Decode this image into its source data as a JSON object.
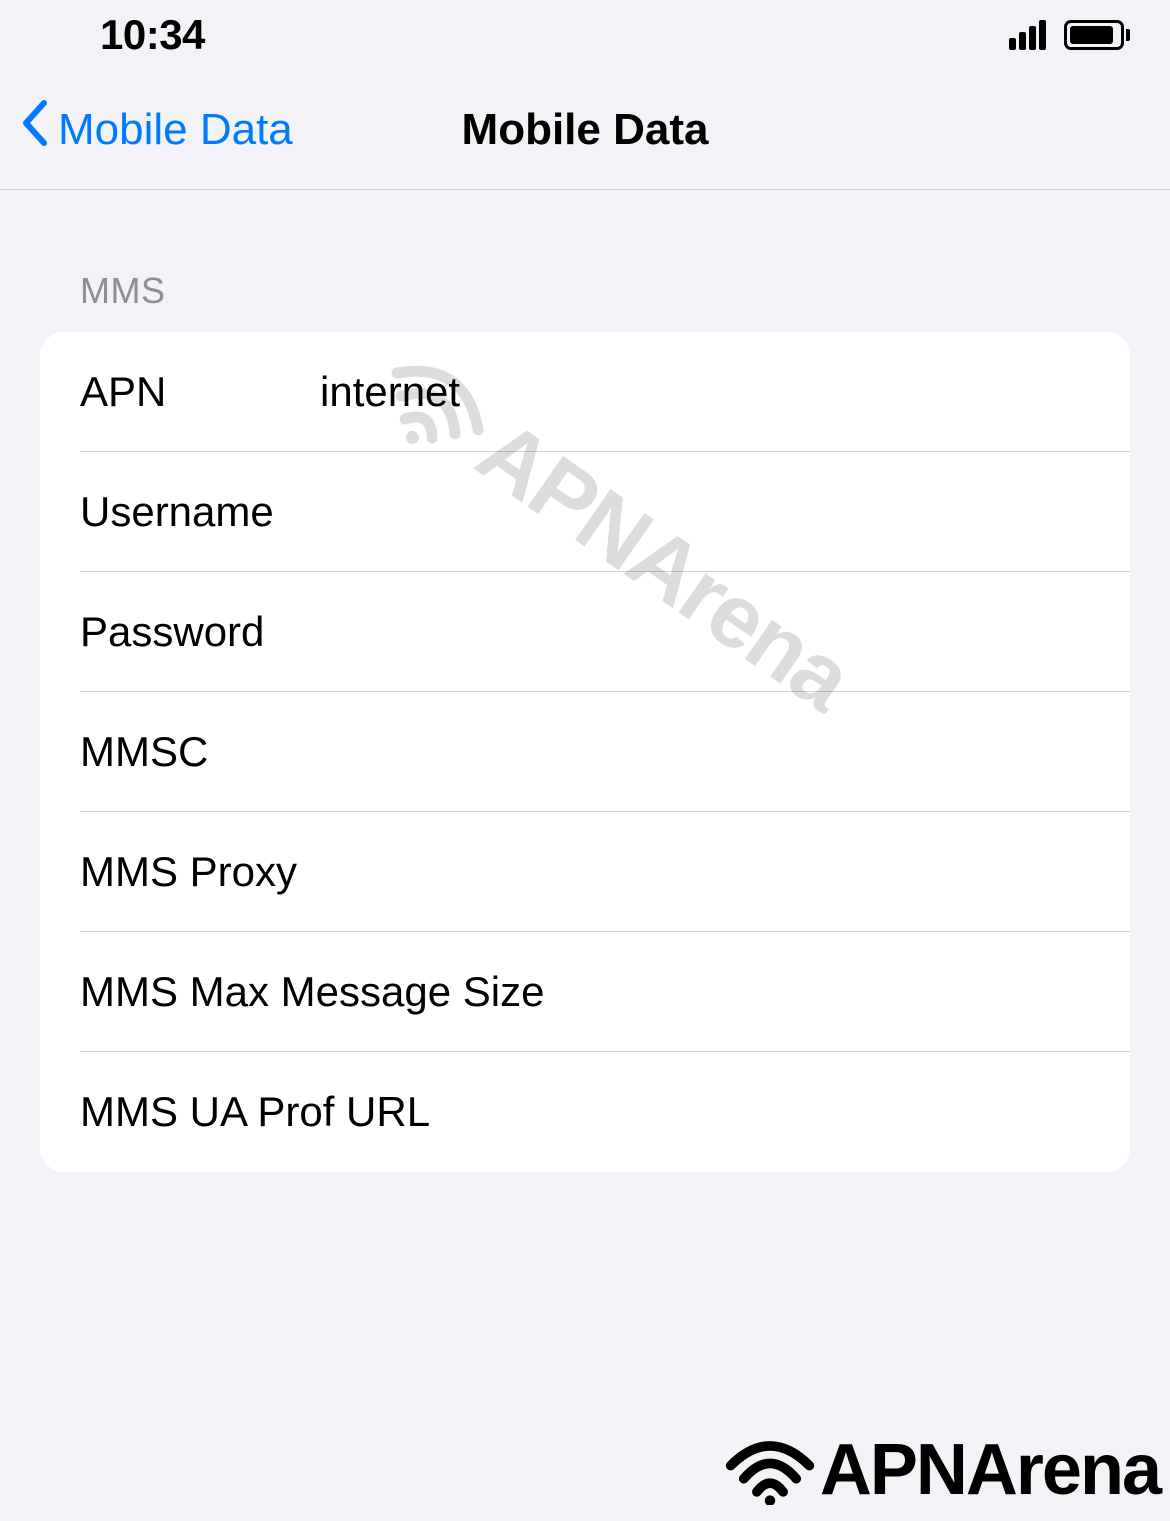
{
  "status_bar": {
    "time": "10:34"
  },
  "nav": {
    "back_label": "Mobile Data",
    "title": "Mobile Data"
  },
  "section": {
    "header": "MMS",
    "rows": [
      {
        "label": "APN",
        "value": "internet"
      },
      {
        "label": "Username",
        "value": ""
      },
      {
        "label": "Password",
        "value": ""
      },
      {
        "label": "MMSC",
        "value": ""
      },
      {
        "label": "MMS Proxy",
        "value": ""
      },
      {
        "label": "MMS Max Message Size",
        "value": ""
      },
      {
        "label": "MMS UA Prof URL",
        "value": ""
      }
    ]
  },
  "brand": {
    "name": "APNArena"
  }
}
